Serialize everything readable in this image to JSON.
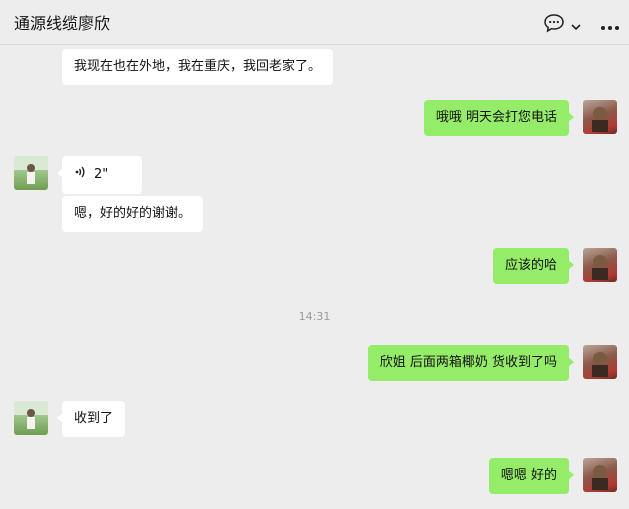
{
  "header": {
    "title": "通源线缆廖欣"
  },
  "messages": [
    {
      "side": "left",
      "text": "我现在也在外地，我在重庆，我回老家了。"
    },
    {
      "side": "right",
      "text": "哦哦 明天会打您电话"
    },
    {
      "side": "left",
      "type": "voice",
      "duration": "2\""
    },
    {
      "side": "left",
      "text": "嗯，好的好的谢谢。"
    },
    {
      "side": "right",
      "text": "应该的哈"
    },
    {
      "type": "time",
      "text": "14:31"
    },
    {
      "side": "right",
      "text": "欣姐 后面两箱椰奶 货收到了吗"
    },
    {
      "side": "left",
      "text": "收到了"
    },
    {
      "side": "right",
      "text": "嗯嗯 好的"
    }
  ],
  "colors": {
    "background": "#ededed",
    "outgoing_bubble": "#95ec69",
    "incoming_bubble": "#ffffff"
  },
  "icons": {
    "chat": "chat-bubble-icon",
    "more": "more-dots-icon",
    "voice": "voice-wave-icon"
  }
}
